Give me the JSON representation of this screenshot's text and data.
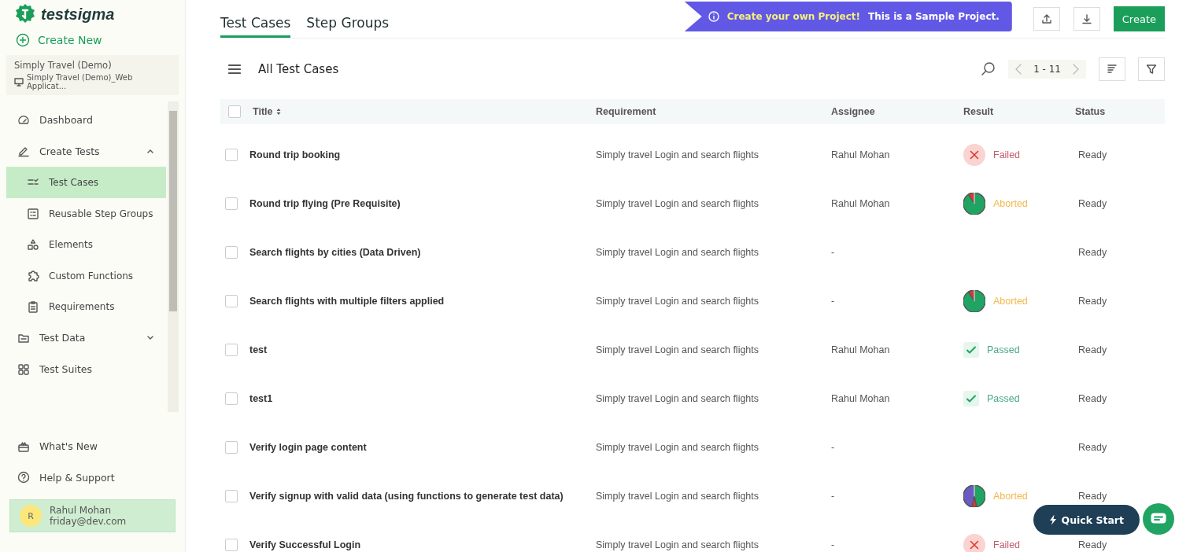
{
  "brand": {
    "name": "testsigma"
  },
  "create_new": {
    "label": "Create New"
  },
  "project": {
    "name": "Simply Travel (Demo)",
    "application": "Simply Travel (Demo)_Web Applicat..."
  },
  "nav": [
    {
      "label": "Dashboard",
      "selected": false
    },
    {
      "label": "Create Tests",
      "selected": false,
      "expanded": true,
      "children": [
        {
          "label": "Test Cases",
          "selected": true
        },
        {
          "label": "Reusable Step Groups",
          "selected": false
        },
        {
          "label": "Elements",
          "selected": false
        },
        {
          "label": "Custom Functions",
          "selected": false
        },
        {
          "label": "Requirements",
          "selected": false
        }
      ]
    },
    {
      "label": "Test Data",
      "selected": false,
      "expanded": false
    },
    {
      "label": "Test Suites",
      "selected": false
    }
  ],
  "bottom_nav": [
    {
      "label": "What's New"
    },
    {
      "label": "Help & Support"
    }
  ],
  "user": {
    "initial": "R",
    "name": "Rahul Mohan",
    "email": "friday@dev.com"
  },
  "tabs": [
    {
      "label": "Test Cases",
      "selected": true
    },
    {
      "label": "Step Groups",
      "selected": false
    }
  ],
  "banner": {
    "highlight": "Create your own Project!",
    "text": "This is a Sample Project."
  },
  "create_button": {
    "label": "Create"
  },
  "list_title": "All Test Cases",
  "pagination": {
    "range": "1 - 11"
  },
  "table": {
    "all_checked": false,
    "columns": [
      "Title",
      "Requirement",
      "Assignee",
      "Result",
      "Status"
    ],
    "rows": [
      {
        "title": "Round trip booking",
        "requirement": "Simply travel Login and search flights",
        "assignee": "Rahul Mohan",
        "result": {
          "kind": "failed",
          "label": "Failed"
        },
        "status": "Ready",
        "checked": false
      },
      {
        "title": "Round trip flying (Pre Requisite)",
        "requirement": "Simply travel Login and search flights",
        "assignee": "Rahul Mohan",
        "result": {
          "kind": "aborted",
          "label": "Aborted"
        },
        "status": "Ready",
        "checked": false
      },
      {
        "title": "Search flights by cities (Data Driven)",
        "requirement": "Simply travel Login and search flights",
        "assignee": "-",
        "result": {
          "kind": "none"
        },
        "status": "Ready",
        "checked": false
      },
      {
        "title": "Search flights with multiple filters applied",
        "requirement": "Simply travel Login and search flights",
        "assignee": "-",
        "result": {
          "kind": "aborted",
          "label": "Aborted"
        },
        "status": "Ready",
        "checked": false
      },
      {
        "title": "test",
        "requirement": "Simply travel Login and search flights",
        "assignee": "Rahul Mohan",
        "result": {
          "kind": "passed",
          "label": "Passed"
        },
        "status": "Ready",
        "checked": false
      },
      {
        "title": "test1",
        "requirement": "Simply travel Login and search flights",
        "assignee": "Rahul Mohan",
        "result": {
          "kind": "passed",
          "label": "Passed"
        },
        "status": "Ready",
        "checked": false
      },
      {
        "title": "Verify login page content",
        "requirement": "Simply travel Login and search flights",
        "assignee": "-",
        "result": {
          "kind": "none"
        },
        "status": "Ready",
        "checked": false
      },
      {
        "title": "Verify signup with valid data (using functions to generate test data)",
        "requirement": "Simply travel Login and search flights",
        "assignee": "-",
        "result": {
          "kind": "aborted-mixed",
          "label": "Aborted"
        },
        "status": "Ready",
        "checked": false
      },
      {
        "title": "Verify Successful Login",
        "requirement": "Simply travel Login and search flights",
        "assignee": "-",
        "result": {
          "kind": "failed",
          "label": "Failed"
        },
        "status": "Ready",
        "checked": false
      }
    ]
  },
  "quick_start": {
    "label": "Quick Start"
  }
}
